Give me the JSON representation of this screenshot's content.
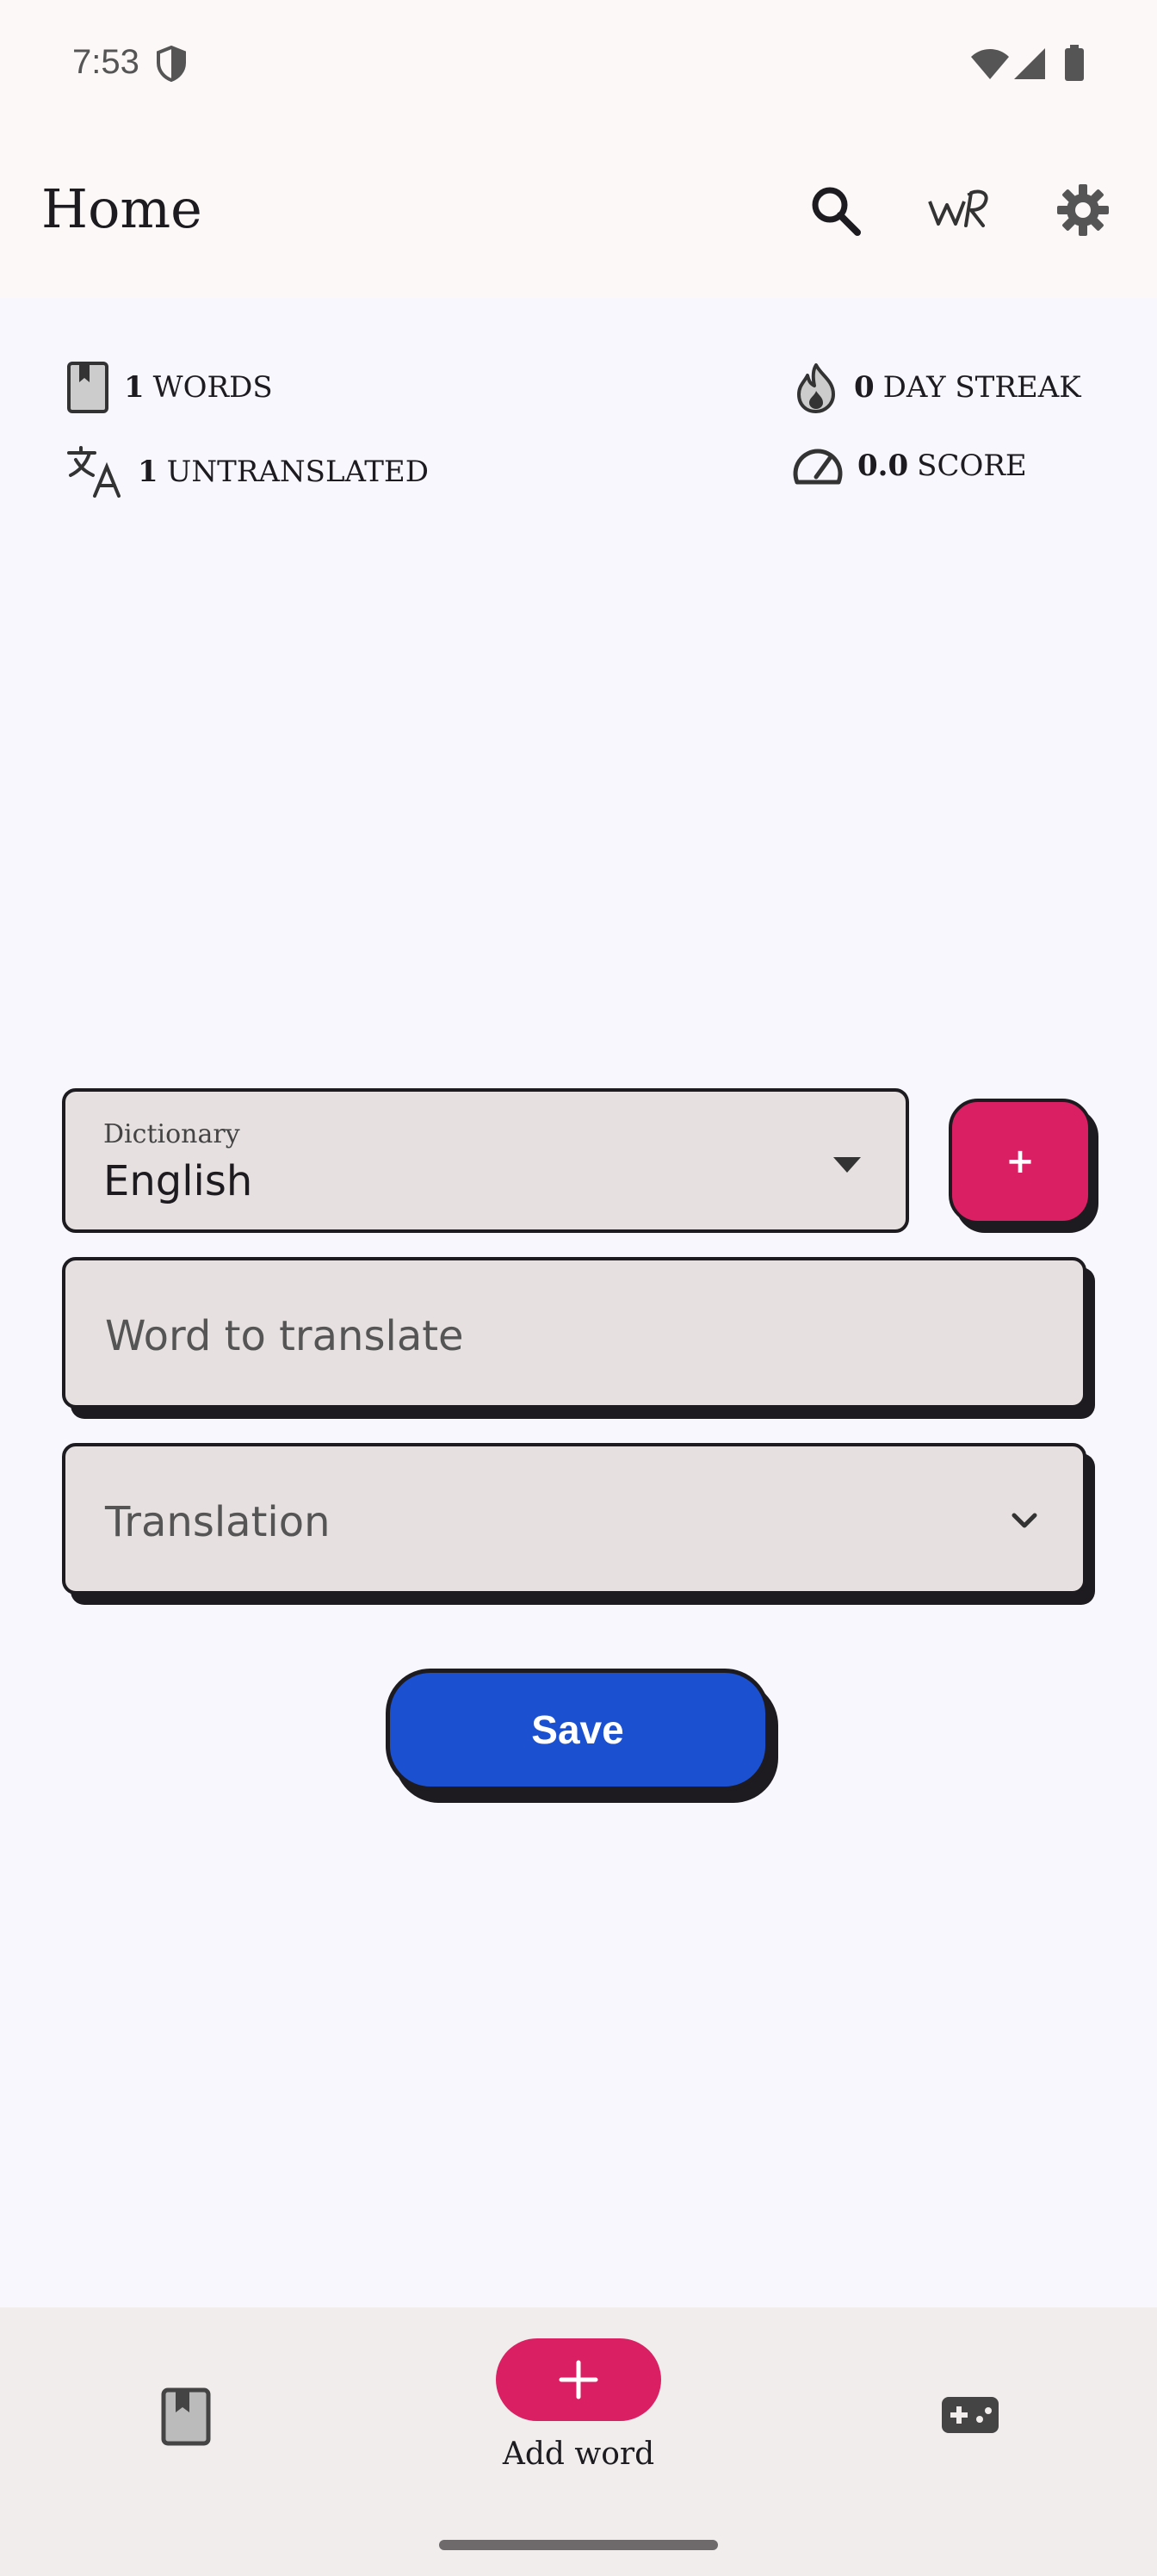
{
  "status": {
    "time": "7:53"
  },
  "appbar": {
    "title": "Home"
  },
  "stats": {
    "words": {
      "value": "1",
      "label": "WORDS"
    },
    "untranslated": {
      "value": "1",
      "label": "UNTRANSLATED"
    },
    "streak": {
      "value": "0",
      "label": "DAY STREAK"
    },
    "score": {
      "value": "0.0",
      "label": "SCORE"
    }
  },
  "form": {
    "dictionary_label": "Dictionary",
    "dictionary_value": "English",
    "add_dictionary_label": "+",
    "word_placeholder": "Word to translate",
    "translation_placeholder": "Translation",
    "save_label": "Save"
  },
  "nav": {
    "add_word_label": "Add word"
  },
  "colors": {
    "accent_pink": "#db1f63",
    "accent_blue": "#1b50d1"
  }
}
